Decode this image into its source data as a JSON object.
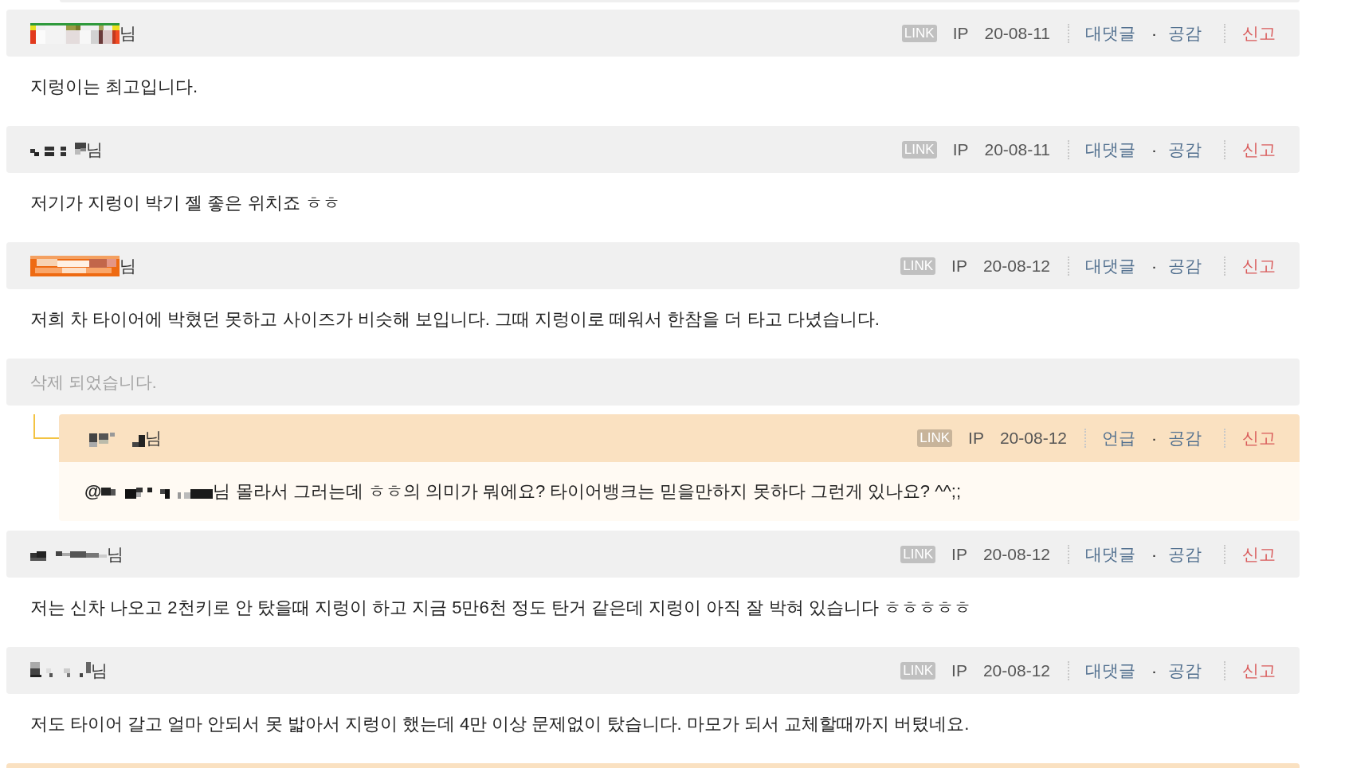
{
  "comments": [
    {
      "kind": "comment",
      "highlighted": false,
      "nickname_suffix": "님",
      "link_badge": "LINK",
      "ip": "IP",
      "date": "20-08-11",
      "actions": [
        "대댓글",
        "공감"
      ],
      "action_separator": "·",
      "report": "신고",
      "text": "지렁이는 최고입니다."
    },
    {
      "kind": "comment",
      "highlighted": false,
      "nickname_suffix": "님",
      "link_badge": "LINK",
      "ip": "IP",
      "date": "20-08-11",
      "actions": [
        "대댓글",
        "공감"
      ],
      "action_separator": "·",
      "report": "신고",
      "text": "저기가 지렁이 박기 젤 좋은 위치죠 ㅎㅎ"
    },
    {
      "kind": "comment",
      "highlighted": false,
      "nickname_suffix": "님",
      "link_badge": "LINK",
      "ip": "IP",
      "date": "20-08-12",
      "actions": [
        "대댓글",
        "공감"
      ],
      "action_separator": "·",
      "report": "신고",
      "text": "저희 차 타이어에 박혔던 못하고 사이즈가 비슷해 보입니다. 그때 지렁이로 떼워서 한참을 더 타고 다녔습니다."
    },
    {
      "kind": "deleted",
      "text": "삭제 되었습니다.",
      "children": [
        {
          "kind": "comment",
          "highlighted": true,
          "nickname_suffix": "님",
          "link_badge": "LINK",
          "ip": "IP",
          "date": "20-08-12",
          "actions": [
            "언급",
            "공감"
          ],
          "action_separator": "·",
          "report": "신고",
          "mention": {
            "at": "@",
            "suffix": "님"
          },
          "text": "몰라서 그러는데 ㅎㅎ의 의미가 뭐에요? 타이어뱅크는 믿을만하지 못하다 그런게 있나요? ^^;;"
        }
      ]
    },
    {
      "kind": "comment",
      "highlighted": false,
      "nickname_suffix": "님",
      "link_badge": "LINK",
      "ip": "IP",
      "date": "20-08-12",
      "actions": [
        "대댓글",
        "공감"
      ],
      "action_separator": "·",
      "report": "신고",
      "text": "저는 신차 나오고 2천키로 안 탔을때 지렁이 하고 지금 5만6천 정도 탄거 같은데 지렁이 아직 잘 박혀 있습니다 ㅎㅎㅎㅎㅎ"
    },
    {
      "kind": "comment",
      "highlighted": false,
      "nickname_suffix": "님",
      "link_badge": "LINK",
      "ip": "IP",
      "date": "20-08-12",
      "actions": [
        "대댓글",
        "공감"
      ],
      "action_separator": "·",
      "report": "신고",
      "text": "저도 타이어 갈고 얼마 안되서 못 밟아서 지렁이 했는데 4만 이상 문제없이 탔습니다. 마모가 되서 교체할때까지 버텼네요."
    },
    {
      "kind": "cut",
      "highlighted": true
    }
  ]
}
